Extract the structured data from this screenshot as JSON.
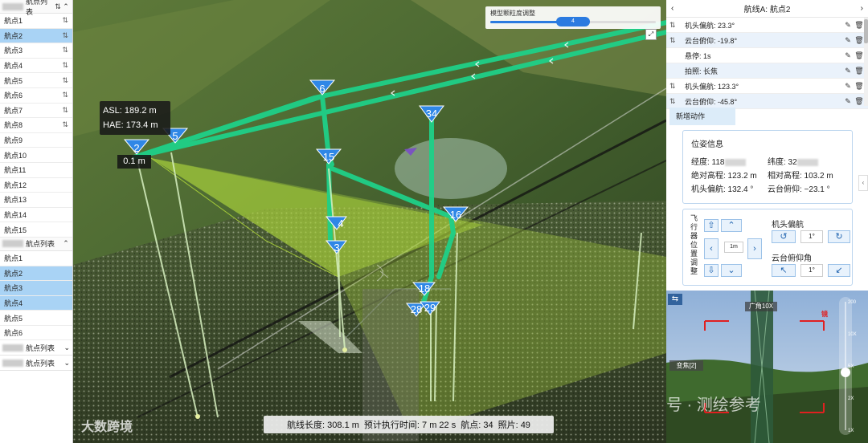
{
  "left_panel": {
    "group1": {
      "title": "航点列表",
      "sort_icon": "swap-vert-icon",
      "collapse_icon": "chevron-up-icon",
      "items": [
        {
          "label": "航点1",
          "selected": false,
          "swap": true
        },
        {
          "label": "航点2",
          "selected": true,
          "swap": true
        },
        {
          "label": "航点3",
          "selected": false,
          "swap": true
        },
        {
          "label": "航点4",
          "selected": false,
          "swap": true
        },
        {
          "label": "航点5",
          "selected": false,
          "swap": true
        },
        {
          "label": "航点6",
          "selected": false,
          "swap": true
        },
        {
          "label": "航点7",
          "selected": false,
          "swap": true
        },
        {
          "label": "航点8",
          "selected": false,
          "swap": true
        },
        {
          "label": "航点9",
          "selected": false,
          "swap": false
        },
        {
          "label": "航点10",
          "selected": false,
          "swap": false
        },
        {
          "label": "航点11",
          "selected": false,
          "swap": false
        },
        {
          "label": "航点12",
          "selected": false,
          "swap": false
        },
        {
          "label": "航点13",
          "selected": false,
          "swap": false
        },
        {
          "label": "航点14",
          "selected": false,
          "swap": false
        },
        {
          "label": "航点15",
          "selected": false,
          "swap": false
        }
      ]
    },
    "group2": {
      "title": "航点列表",
      "items": [
        {
          "label": "航点1",
          "selected": false
        },
        {
          "label": "航点2",
          "selected": true
        },
        {
          "label": "航点3",
          "selected": true
        },
        {
          "label": "航点4",
          "selected": true
        },
        {
          "label": "航点5",
          "selected": false
        },
        {
          "label": "航点6",
          "selected": false
        }
      ]
    },
    "group3": {
      "title": "航点列表"
    },
    "group4": {
      "title": "航点列表"
    }
  },
  "map": {
    "slider": {
      "title": "模型颗粒度调整",
      "value": "4",
      "level_fraction": 0.45
    },
    "expand_icon": "expand-icon",
    "altitude": {
      "asl": "ASL: 189.2 m",
      "hae": "HAE: 173.4 m"
    },
    "height_tag": "0.1 m",
    "waypoint_markers": [
      "2",
      "5",
      "6",
      "15",
      "4",
      "3",
      "34",
      "16",
      "18",
      "28",
      "29"
    ],
    "stats": {
      "route_length": "航线长度: 308.1 m",
      "est_time": "预计执行时间: 7 m 22 s",
      "waypoints": "航点: 34",
      "photos": "照片: 49"
    },
    "watermark": "大数跨境"
  },
  "right_panel": {
    "header": {
      "title": "航线A: 航点2",
      "back_icon": "chevron-left-icon",
      "next_icon": "chevron-right-icon"
    },
    "actions": [
      {
        "label": "机头偏航: 23.3°",
        "swap": true
      },
      {
        "label": "云台俯仰: -19.8°",
        "swap": true
      },
      {
        "label": "悬停: 1s",
        "swap": false
      },
      {
        "label": "拍照: 长焦",
        "swap": false
      },
      {
        "label": "机头偏航: 123.3°",
        "swap": true
      },
      {
        "label": "云台俯仰: -45.8°",
        "swap": true
      }
    ],
    "add_action": "新增动作",
    "pose": {
      "title": "位姿信息",
      "lon_label": "经度: 118",
      "lat_label": "纬度: 32",
      "abs_alt": "绝对高程: 123.2 m",
      "rel_alt": "相对高程: 103.2 m",
      "yaw": "机头偏航: 132.4 °",
      "gimbal": "云台俯仰: −23.1 °"
    },
    "control": {
      "vertical_label": "飞行器位置调整",
      "step": "1m",
      "yaw_title": "机头偏航",
      "yaw_step": "1°",
      "pitch_title": "云台俯仰角",
      "pitch_step": "1°"
    },
    "camera": {
      "zoom": "广角10X",
      "focus": "变焦[2]",
      "label": "镜",
      "watermark": "公众号 · 测绘参考",
      "zoom_scale": [
        "200",
        "10X",
        "5X",
        "2X",
        "1X"
      ]
    },
    "side_tab": "‹"
  }
}
